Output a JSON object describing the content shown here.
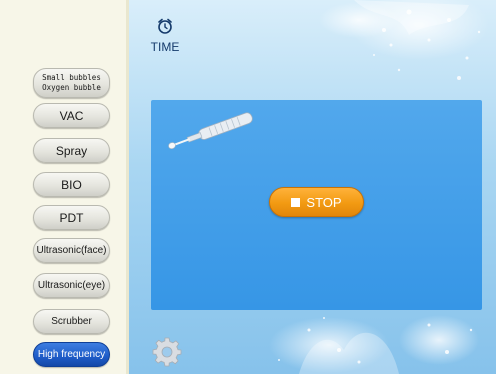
{
  "sidebar": {
    "modes": [
      {
        "label": "Small bubbles",
        "label2": "Oxygen bubble"
      },
      {
        "label": "VAC"
      },
      {
        "label": "Spray"
      },
      {
        "label": "BIO"
      },
      {
        "label": "PDT"
      },
      {
        "label": "Ultrasonic(face)"
      },
      {
        "label": "Ultrasonic(eye)"
      },
      {
        "label": "Scrubber"
      },
      {
        "label": "High frequency",
        "active": true
      }
    ]
  },
  "header": {
    "time_label": "TIME",
    "clock_icon": "alarm-clock-icon"
  },
  "panel": {
    "stop_label": "STOP",
    "device_icon": "high-frequency-probe-icon"
  },
  "footer": {
    "settings_icon": "gear-icon"
  },
  "colors": {
    "active_mode": "#1e5cc8",
    "stop_button": "#f29a12",
    "panel": "#3d9be8",
    "sidebar": "#f7f6e8"
  }
}
